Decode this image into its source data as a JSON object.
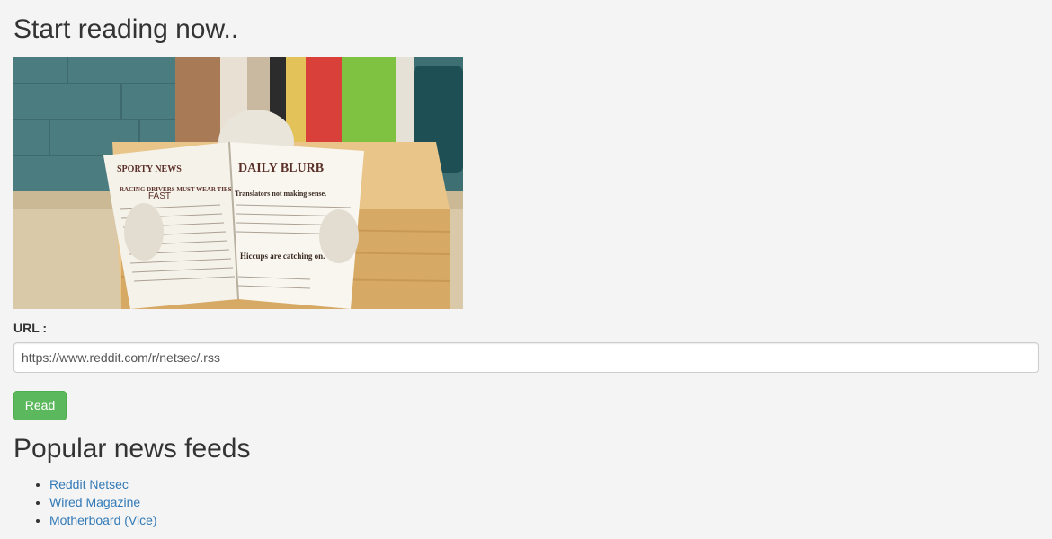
{
  "page": {
    "heading": "Start reading now..",
    "hero_image": {
      "paper_left_title": "SPORTY NEWS",
      "paper_left_headline": "RACING DRIVERS MUST WEAR TIES",
      "paper_left_badge": "FAST",
      "paper_right_title": "DAILY BLURB",
      "paper_right_headline": "Translators not making sense.",
      "paper_right_story": "Hiccups are catching on."
    }
  },
  "form": {
    "url_label": "URL :",
    "url_value": "https://www.reddit.com/r/netsec/.rss",
    "read_label": "Read"
  },
  "feeds": {
    "heading": "Popular news feeds",
    "items": [
      {
        "label": "Reddit Netsec"
      },
      {
        "label": "Wired Magazine"
      },
      {
        "label": "Motherboard (Vice)"
      }
    ]
  },
  "colors": {
    "background": "#f4f4f4",
    "link": "#337ab7",
    "button": "#5cb85c"
  }
}
